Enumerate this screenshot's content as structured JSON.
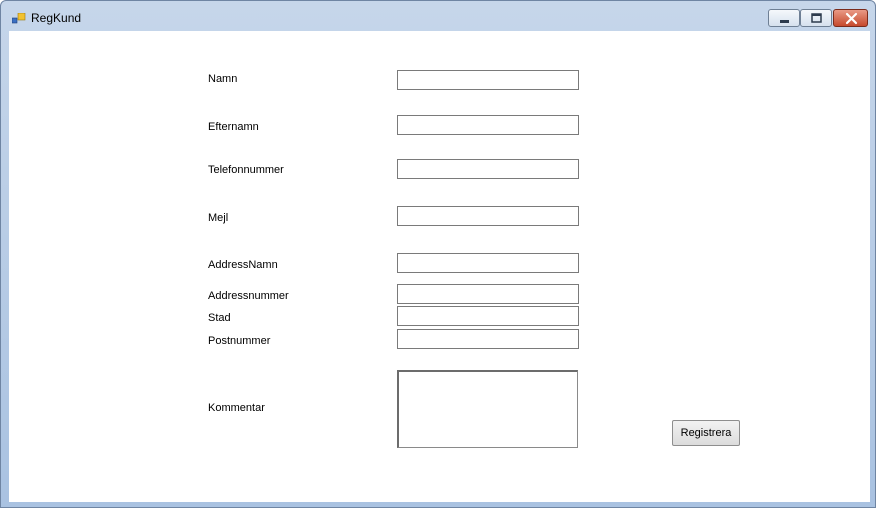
{
  "window": {
    "title": "RegKund",
    "icons": {
      "app": "app-icon",
      "minimize": "minimize-icon",
      "maximize": "maximize-icon",
      "close": "close-icon"
    }
  },
  "form": {
    "namn_label": "Namn",
    "efternamn_label": "Efternamn",
    "telefonnummer_label": "Telefonnummer",
    "mejl_label": "Mejl",
    "addressnamn_label": "AddressNamn",
    "addressnummer_label": "Addressnummer",
    "stad_label": "Stad",
    "postnummer_label": "Postnummer",
    "kommentar_label": "Kommentar",
    "namn_value": "",
    "efternamn_value": "",
    "telefonnummer_value": "",
    "mejl_value": "",
    "addressnamn_value": "",
    "addressnummer_value": "",
    "stad_value": "",
    "postnummer_value": "",
    "kommentar_value": "",
    "submit_label": "Registrera"
  },
  "colors": {
    "titlebar": "#b9cde6",
    "close_button": "#c64a2d",
    "client_bg": "#ffffff"
  }
}
